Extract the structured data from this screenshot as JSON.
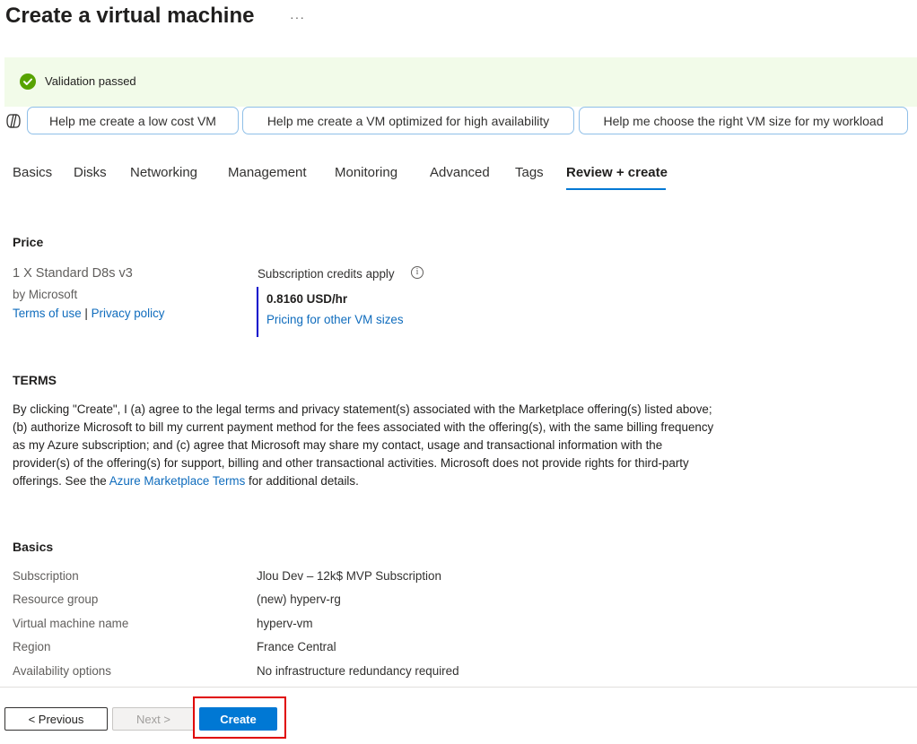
{
  "header": {
    "title": "Create a virtual machine",
    "more": "···"
  },
  "banner": {
    "text": "Validation passed",
    "color": "#57a300"
  },
  "copilot": {
    "suggestions": [
      "Help me create a low cost VM",
      "Help me create a VM optimized for high availability",
      "Help me choose the right VM size for my workload"
    ]
  },
  "tabs": [
    "Basics",
    "Disks",
    "Networking",
    "Management",
    "Monitoring",
    "Advanced",
    "Tags",
    "Review + create"
  ],
  "active_tab": "Review + create",
  "price": {
    "heading": "Price",
    "sku": "1 X Standard D8s v3",
    "publisher": "by Microsoft",
    "terms_link": "Terms of use",
    "separator": "|",
    "privacy_link": "Privacy policy",
    "credits_label": "Subscription credits apply",
    "rate": "0.8160 USD/hr",
    "pricing_link": "Pricing for other VM sizes"
  },
  "terms": {
    "heading": "TERMS",
    "text_before": "By clicking \"Create\", I (a) agree to the legal terms and privacy statement(s) associated with the Marketplace offering(s) listed above; (b) authorize Microsoft to bill my current payment method for the fees associated with the offering(s), with the same billing frequency as my Azure subscription; and (c) agree that Microsoft may share my contact, usage and transactional information with the provider(s) of the offering(s) for support, billing and other transactional activities. Microsoft does not provide rights for third-party offerings. See the ",
    "link": "Azure Marketplace Terms",
    "text_after": " for additional details."
  },
  "basics": {
    "heading": "Basics",
    "rows": [
      {
        "label": "Subscription",
        "value": "Jlou Dev – 12k$ MVP Subscription"
      },
      {
        "label": "Resource group",
        "value": "(new) hyperv-rg"
      },
      {
        "label": "Virtual machine name",
        "value": "hyperv-vm"
      },
      {
        "label": "Region",
        "value": "France Central"
      },
      {
        "label": "Availability options",
        "value": "No infrastructure redundancy required"
      }
    ]
  },
  "footer": {
    "previous": "< Previous",
    "next": "Next >",
    "create": "Create"
  }
}
